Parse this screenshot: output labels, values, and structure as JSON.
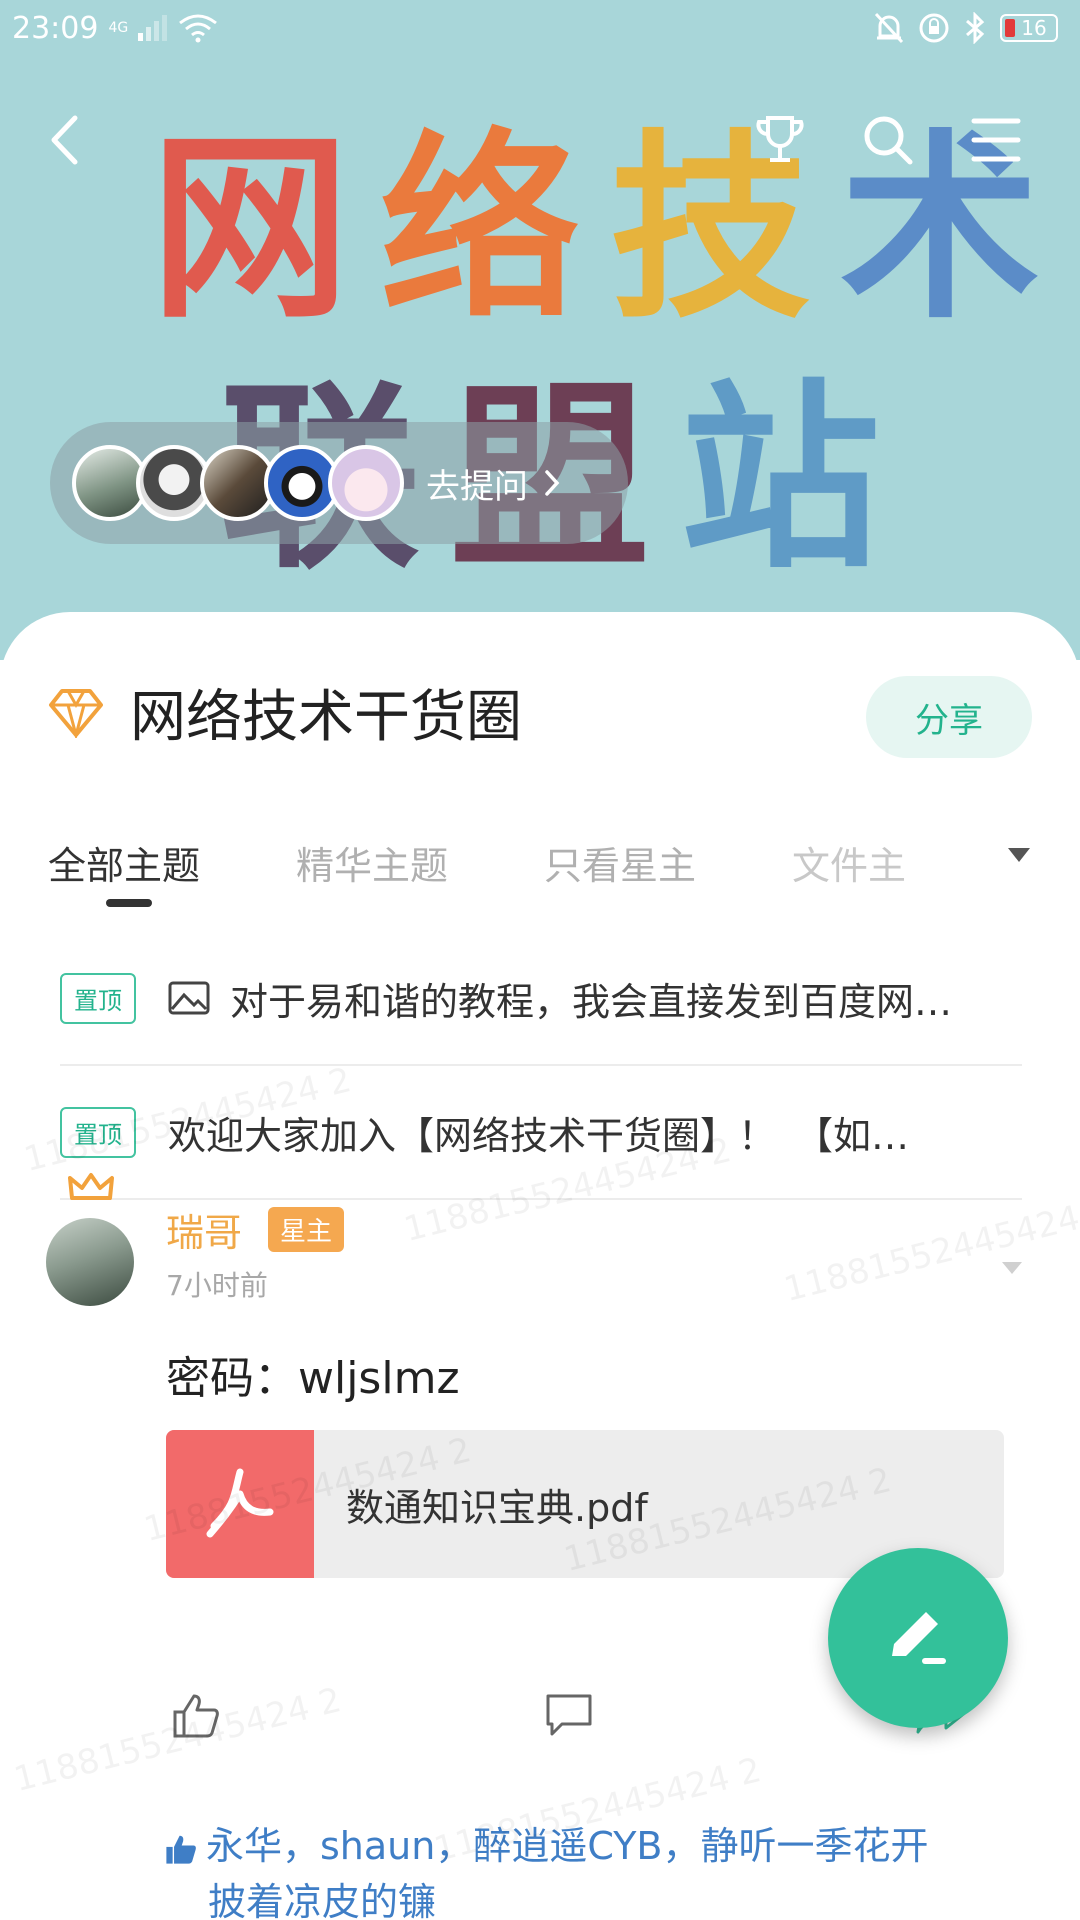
{
  "status_bar": {
    "time": "23:09",
    "network": "4G",
    "battery": "16"
  },
  "banner": {
    "line1": [
      "网",
      "络",
      "技",
      "术"
    ],
    "line2": [
      "联",
      "盟",
      "站"
    ],
    "colors": [
      "#e05a4e",
      "#ea7a3d",
      "#e6b33d",
      "#5b8cc8",
      "#5a4e6b",
      "#6d3f55",
      "#5f9bc6"
    ]
  },
  "ask": {
    "label": "去提问"
  },
  "circle": {
    "title": "网络技术干货圈",
    "share_label": "分享"
  },
  "tabs": [
    "全部主题",
    "精华主题",
    "只看星主",
    "文件主"
  ],
  "pinned": [
    {
      "badge": "置顶",
      "text": "对于易和谐的教程，我会直接发到百度网…",
      "has_image": true
    },
    {
      "badge": "置顶",
      "text": "欢迎大家加入【网络技术干货圈】！　【如…",
      "has_image": false
    }
  ],
  "post": {
    "author": "瑞哥",
    "role_badge": "星主",
    "time": "7小时前",
    "text": "密码：wljslmz",
    "file_name": "数通知识宝典.pdf",
    "likes_line1": "永华，shaun，醉逍遥CYB，静听一季花开",
    "likes_line2": "披着凉皮的镰"
  },
  "watermark": "11881552445424 2"
}
